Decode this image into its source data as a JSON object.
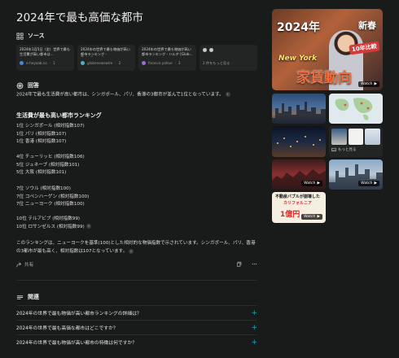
{
  "title": "2024年で最も高価な都市",
  "sources_header": "ソース",
  "sources": [
    {
      "title": "2024年1月5日（金）世界で最も生活費が高い都市は…",
      "site": "e-heyaab.co",
      "num": "1",
      "color": "#4a84d8"
    },
    {
      "title": "2024年の世界で最も物価が高い都市ランキング - GlobeNewswire",
      "site": "globenewswire",
      "num": "2",
      "color": "#4fb0c8"
    },
    {
      "title": "2024年の世界で最も物価が高い都市ランキング - ハルヂ [Glob…",
      "site": "finance.yahoo",
      "num": "3",
      "color": "#9b6bd6"
    }
  ],
  "sources_more": "2 件をもっと見る",
  "answer_header": "回答",
  "intro": "2024年で最も生活費が高い都市は、シンガポール、パリ、香港の3都市が並んで1位となっています。",
  "ranking_title": "生活費が最も高い都市ランキング",
  "ranking_groups": [
    [
      "1位 シンガポール (相対指数107)",
      "1位 パリ (相対指数107)",
      "1位 香港 (相対指数107)"
    ],
    [
      "4位 チューリッヒ (相対指数106)",
      "5位 ジュネーブ (相対指数101)",
      "5位 大阪 (相対指数101)"
    ],
    [
      "7位 ソウル (相対指数100)",
      "7位 コペンハーゲン (相対指数100)",
      "7位 ニューヨーク (相対指数100)"
    ],
    [
      "10位 テルアビブ (相対指数99)",
      "10位 ロサンゼルス (相対指数99)"
    ]
  ],
  "footnote": "このランキングは、ニューヨークを基準(100)とした相対的な物価指数で示されています。シンガポール、パリ、香港の3都市が最も高く、相対指数は107となっています。",
  "share_label": "共有",
  "related_header": "関連",
  "related": [
    "2024年の世界で最も物価が高い都市ランキングの詳細は？",
    "2024年の世界で最も高価な都市はどこですか？",
    "2024年の世界で最も物価が高い都市の特徴は何ですか？"
  ],
  "media": {
    "main_text1": "2024年",
    "main_text2": "新春",
    "main_ny": "New York",
    "main_tag": "10年比較",
    "main_big": "家賃動向",
    "watch_label": "Watch",
    "more_label": "もっと見る",
    "kanji_1": "不動産バブルが崩壊した",
    "kanji_2": "カリフォルニア",
    "kanji_3": "1億円"
  }
}
